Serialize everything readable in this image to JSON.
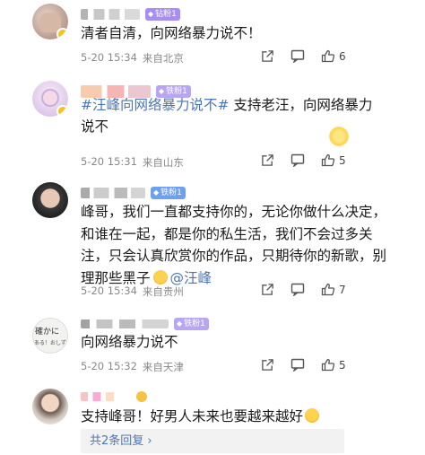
{
  "colors": {
    "link": "#4c76b1",
    "meta": "#888888",
    "badge_purple": "#a88ef0",
    "badge_blue": "#6fa0f0",
    "badge_light_purple": "#b9a6f2",
    "verified": "#f6c21b"
  },
  "comments": [
    {
      "badge": "钻粉1",
      "text": "清者自清，向网络暴力说不！",
      "date": "5-20 15:34",
      "location": "来自北京",
      "likes": "6"
    },
    {
      "badge": "铁粉1",
      "hashtag": "#汪峰向网络暴力说不#",
      "text": " 支持老汪，向网络暴力说不",
      "date": "5-20 15:31",
      "location": "来自山东",
      "likes": "5"
    },
    {
      "badge": "铁粉1",
      "text": "峰哥，我们一直都支持你的，无论你做什么决定，和谁在一起，都是你的私生活，我们不会过多关注，只会认真欣赏你的作品，只期待你的新歌，别理那些黑子",
      "mention": "@汪峰",
      "date": "5-20 15:34",
      "location": "来自贵州",
      "likes": "7"
    },
    {
      "avatar_text_1": "確かに",
      "avatar_text_2": "ある！おしず",
      "badge": "铁粉1",
      "text": "向网络暴力说不",
      "date": "5-20 15:32",
      "location": "来自天津",
      "likes": "5"
    },
    {
      "text": "支持峰哥！好男人未来也要越来越好",
      "replies": "共2条回复 ›"
    }
  ],
  "icons": {
    "share": "share-icon",
    "comment": "comment-icon",
    "like": "thumbs-up-icon"
  }
}
